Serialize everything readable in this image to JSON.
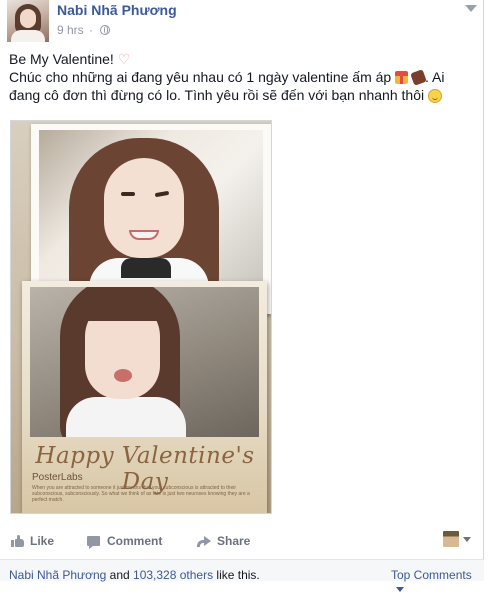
{
  "post": {
    "author": "Nabi Nhã Phương",
    "timestamp": "9 hrs",
    "text_line1": "Be My Valentine!",
    "text_line2_a": "Chúc cho những ai đang yêu nhau có 1 ngày valentine ấm áp",
    "text_line2_b": ". Ai đang cô đơn thì đừng có lo. Tình yêu rồi sẽ đến với bạn nhanh thôi",
    "icons": [
      "heart-icon",
      "gift-icon",
      "candy-icon",
      "smile-icon",
      "globe-icon"
    ]
  },
  "photo": {
    "title": "Happy Valentine's Day",
    "brand": "PosterLabs",
    "fineprint": "When you are attracted to someone it just means that your subconscious is attracted to their subconscious, subconsciously. So what we think of as fate is just two neuroses knowing they are a perfect match."
  },
  "actions": {
    "like": "Like",
    "comment": "Comment",
    "share": "Share"
  },
  "likes": {
    "name": "Nabi Nhã Phương",
    "and": "and",
    "others": "103,328 others",
    "suffix": "like this."
  },
  "top_comments": "Top Comments",
  "colors": {
    "link": "#3b5998",
    "muted": "#9197a3",
    "footer_bg": "#f6f7f9"
  }
}
